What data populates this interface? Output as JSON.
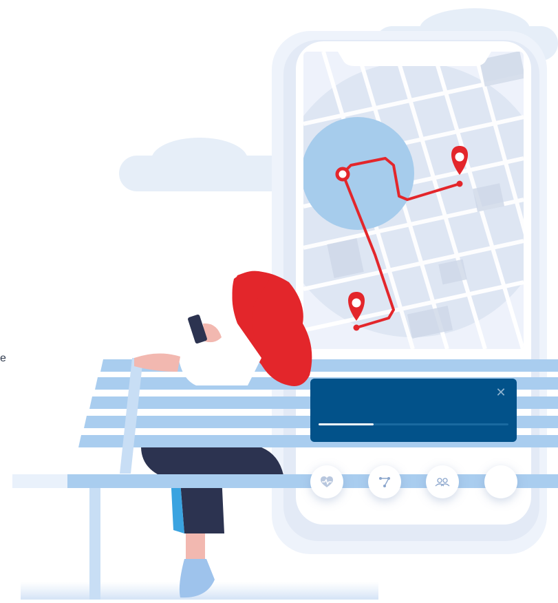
{
  "edge_glyph": "e",
  "notification": {
    "close_glyph": "✕",
    "progress": 0.29
  },
  "tab_bar": {
    "items": [
      {
        "icon": "heart-icon"
      },
      {
        "icon": "route-icon"
      },
      {
        "icon": "people-icon"
      },
      {
        "icon": "blank"
      }
    ]
  },
  "colors": {
    "route": "#e3262b",
    "map_circle": "#a6ccec",
    "notification_bg": "#02528a",
    "bench": "#a9cdef",
    "hair": "#e3262b",
    "trousers": "#2c3350"
  }
}
